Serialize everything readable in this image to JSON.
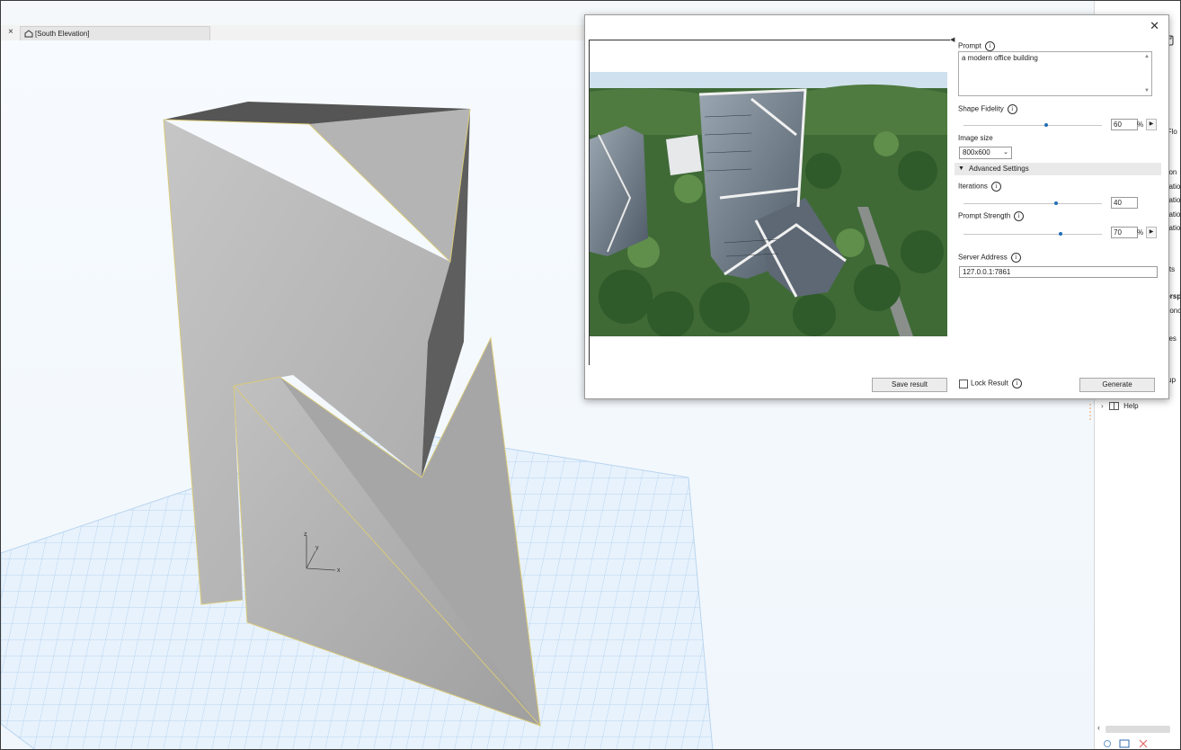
{
  "tab": {
    "close_glyph": "×",
    "title": "[South Elevation]"
  },
  "sidepanel": {
    "partial_labels": [
      "ap",
      "d Flo",
      "ation",
      "evation",
      "evation",
      "evation",
      "evatio",
      "s",
      "ents",
      "Persp",
      "Axonc",
      "exes",
      "roup"
    ],
    "help_label": "Help"
  },
  "dialog": {
    "close_glyph": "✕",
    "prompt_label": "Prompt",
    "prompt_value": "a modern office building",
    "shape_fidelity_label": "Shape Fidelity",
    "shape_fidelity_value": "60",
    "shape_fidelity_level": 0.6,
    "percent_sign": "%",
    "image_size_label": "Image size",
    "image_size_value": "800x600",
    "advanced_label": "Advanced Settings",
    "iterations_label": "Iterations",
    "iterations_value": "40",
    "prompt_strength_label": "Prompt Strength",
    "prompt_strength_value": "70",
    "prompt_strength_level": 0.7,
    "server_address_label": "Server Address",
    "server_address_value": "127.0.0.1:7861",
    "save_result_label": "Save result",
    "lock_result_label": "Lock Result",
    "generate_label": "Generate",
    "info_glyph": "i"
  },
  "colors": {
    "accent": "#1e6fb5",
    "grid": "#9cc3ea",
    "model_light": "#bdbdbd",
    "model_dark": "#5c5c5c",
    "edge_highlight": "#d9c97a"
  }
}
